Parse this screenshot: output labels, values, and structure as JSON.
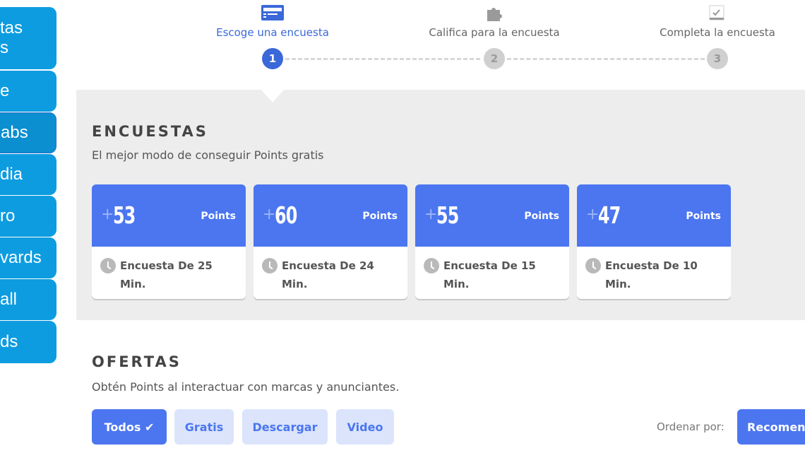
{
  "sidebar": {
    "items": [
      {
        "label": "tas\ns"
      },
      {
        "label": "e"
      },
      {
        "label": "abs"
      },
      {
        "label": "dia"
      },
      {
        "label": "ro"
      },
      {
        "label": "vards"
      },
      {
        "label": "all"
      },
      {
        "label": "ds"
      }
    ]
  },
  "stepper": {
    "steps": [
      {
        "label": "Escoge una encuesta",
        "number": "1",
        "icon": "survey-list-icon"
      },
      {
        "label": "Califica para la encuesta",
        "number": "2",
        "icon": "puzzle-icon"
      },
      {
        "label": "Completa la encuesta",
        "number": "3",
        "icon": "checklist-icon"
      }
    ]
  },
  "surveys": {
    "title": "ENCUESTAS",
    "subtitle": "El mejor modo de conseguir Points gratis",
    "cards": [
      {
        "plus": "+",
        "points": "53",
        "points_label": "Points",
        "duration": "Encuesta De 25 Min."
      },
      {
        "plus": "+",
        "points": "60",
        "points_label": "Points",
        "duration": "Encuesta De 24 Min."
      },
      {
        "plus": "+",
        "points": "55",
        "points_label": "Points",
        "duration": "Encuesta De 15 Min."
      },
      {
        "plus": "+",
        "points": "47",
        "points_label": "Points",
        "duration": "Encuesta De 10 Min."
      }
    ]
  },
  "offers": {
    "title": "OFERTAS",
    "subtitle": "Obtén Points al interactuar con marcas y anunciantes.",
    "filters": [
      {
        "label": "Todos ✔"
      },
      {
        "label": "Gratis"
      },
      {
        "label": "Descargar"
      },
      {
        "label": "Video"
      }
    ],
    "sort_label": "Ordenar por:",
    "sort_value": "Recomen"
  },
  "colors": {
    "accent": "#4b76f0",
    "sidebar": "#0d9ce0",
    "panel_bg": "#ededed"
  }
}
